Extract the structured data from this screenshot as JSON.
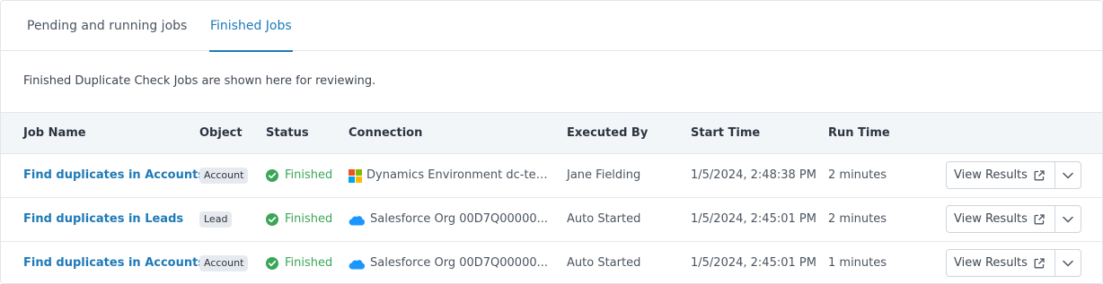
{
  "tabs": [
    {
      "label": "Pending and running jobs",
      "active": false
    },
    {
      "label": "Finished Jobs",
      "active": true
    }
  ],
  "description": "Finished Duplicate Check Jobs are shown here for reviewing.",
  "table": {
    "headers": [
      "Job Name",
      "Object",
      "Status",
      "Connection",
      "Executed By",
      "Start Time",
      "Run Time"
    ],
    "rows": [
      {
        "job_name": "Find duplicates in Accounts",
        "object": "Account",
        "status": "Finished",
        "connection_icon": "microsoft-icon",
        "connection": "Dynamics Environment dc-test...",
        "executed_by": "Jane Fielding",
        "start_time": "1/5/2024, 2:48:38 PM",
        "run_time": "2 minutes",
        "action_label": "View Results"
      },
      {
        "job_name": "Find duplicates in Leads",
        "object": "Lead",
        "status": "Finished",
        "connection_icon": "salesforce-cloud-icon",
        "connection": "Salesforce Org 00D7Q00000...",
        "executed_by": "Auto Started",
        "start_time": "1/5/2024, 2:45:01 PM",
        "run_time": "2 minutes",
        "action_label": "View Results"
      },
      {
        "job_name": "Find duplicates in Accounts",
        "object": "Account",
        "status": "Finished",
        "connection_icon": "salesforce-cloud-icon",
        "connection": "Salesforce Org 00D7Q00000...",
        "executed_by": "Auto Started",
        "start_time": "1/5/2024, 2:45:01 PM",
        "run_time": "1 minutes",
        "action_label": "View Results"
      }
    ]
  },
  "colors": {
    "accent": "#1e7ab8",
    "success": "#3aa657",
    "header_bg": "#f3f6f9",
    "salesforce": "#1b96ff"
  }
}
